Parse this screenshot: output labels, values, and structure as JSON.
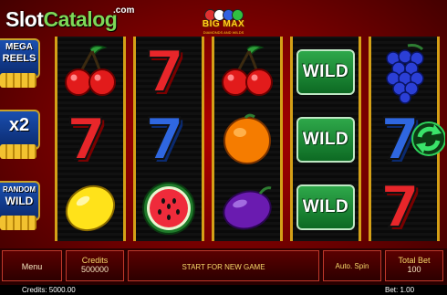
{
  "header": {
    "brand_slot": "Slot",
    "brand_catalog": "Catalog",
    "brand_com": ".com",
    "game_logo_title": "BIG MAX",
    "game_logo_sub": "DIAMONDS AND WILDS"
  },
  "side_features": [
    {
      "line1": "MEGA",
      "line2": "REELS"
    },
    {
      "line1": "x2",
      "line2": ""
    },
    {
      "line1": "RANDOM",
      "line2": "WILD"
    }
  ],
  "reels": [
    [
      "cherry",
      "seven-red",
      "lemon"
    ],
    [
      "seven-red",
      "seven-blue",
      "watermelon"
    ],
    [
      "cherry",
      "orange",
      "plum"
    ],
    [
      "wild",
      "wild",
      "wild"
    ],
    [
      "grapes",
      "seven-blue",
      "seven-red"
    ]
  ],
  "wild_label": "WILD",
  "controls": {
    "menu": "Menu",
    "credits_label": "Credits",
    "credits_value": "500000",
    "start": "START FOR NEW GAME",
    "auto_spin": "Auto. Spin",
    "total_bet_label": "Total Bet",
    "total_bet_value": "100"
  },
  "status": {
    "credits": "Credits: 5000.00",
    "bet": "Bet: 1.00"
  },
  "colors": {
    "background": "#8b0000",
    "reel_frame": "#d4a017",
    "wild_green": "#1e8a36",
    "brand_green": "#7ed957"
  }
}
